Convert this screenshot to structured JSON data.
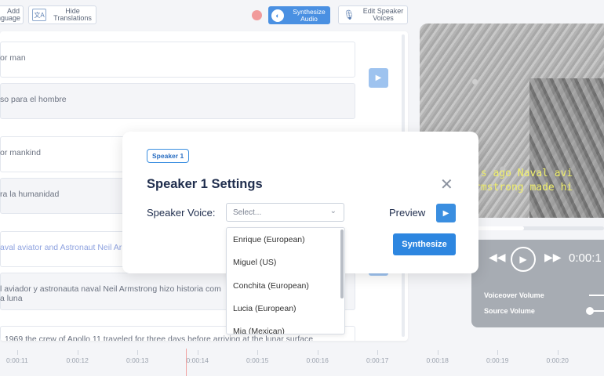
{
  "toolbar": {
    "add_language": [
      "Add",
      "nguage"
    ],
    "hide_translations": [
      "Hide",
      "Translations"
    ],
    "synthesize_audio": [
      "Synthesize",
      "Audio"
    ],
    "edit_speaker_voices": [
      "Edit Speaker",
      "Voices"
    ]
  },
  "segments": [
    {
      "text": "or man"
    },
    {
      "text": "so para el hombre"
    },
    {
      "text": "or mankind"
    },
    {
      "text": "ra la humanidad"
    },
    {
      "text": "aval aviator and Astronaut Neil Ar"
    },
    {
      "text_line1": "l aviador y astronauta naval Neil Armstrong hizo historia com",
      "text_line2": "a luna"
    },
    {
      "text": ", 1969 the crew of Apollo 11 traveled for three days before arriving at the lunar surface"
    }
  ],
  "video": {
    "subtitle_line1": "'s ago Naval avi",
    "subtitle_line2": "rmstrong made hi"
  },
  "player": {
    "time": "0:00:1",
    "voiceover_label": "Voiceover Volume",
    "source_label": "Source Volume"
  },
  "timeline": {
    "ticks": [
      "0:00:11",
      "0:00:12",
      "0:00:13",
      "0:00:14",
      "0:00:15",
      "0:00:16",
      "0:00:17",
      "0:00:18",
      "0:00:19",
      "0:00:20",
      "0:00:2"
    ]
  },
  "modal": {
    "badge": "Speaker 1",
    "title": "Speaker 1 Settings",
    "voice_label": "Speaker Voice:",
    "select_placeholder": "Select...",
    "preview_label": "Preview",
    "synthesize_label": "Synthesize"
  },
  "dropdown": {
    "options": [
      "Enrique (European)",
      "Miguel (US)",
      "Conchita (European)",
      "Lucia (European)",
      "Mia (Mexican)"
    ]
  },
  "colors": {
    "accent": "#3a8ee0",
    "record": "#f19a9a",
    "subtitle": "#f0ef6a"
  }
}
